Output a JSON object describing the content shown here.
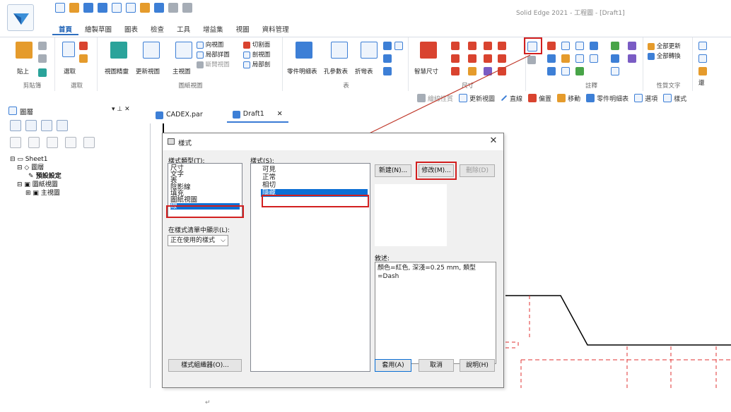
{
  "window": {
    "title": "Solid Edge 2021 - 工程圖 - [Draft1]"
  },
  "ribbon": {
    "tabs": [
      "首頁",
      "繪製草圖",
      "圖表",
      "檢查",
      "工具",
      "增益集",
      "視圖",
      "資料管理"
    ],
    "active_tab": "首頁",
    "clipboard": {
      "paste": "貼上",
      "group": "剪貼簿"
    },
    "select": {
      "select": "選取",
      "group": "選取"
    },
    "views": {
      "wizard": "視圖精靈",
      "update": "更新視圖",
      "main": "主視圖",
      "aux": "向視圖",
      "detail": "局部詳圖",
      "broken": "斷開視圖",
      "section": "切割面",
      "cutaway": "剖視圖",
      "partial": "局部剖",
      "group": "圖紙視圖"
    },
    "table": {
      "parts_list": "零件明細表",
      "hole_table": "孔參數表",
      "bend_table": "折彎表",
      "group": "表"
    },
    "dimension": {
      "smart": "智慧尺寸",
      "group": "尺寸"
    },
    "annotation": {
      "group": "註釋"
    },
    "property_text": {
      "update_all": "全部更新",
      "convert_all": "全部轉換",
      "group": "性質文字"
    },
    "extra": {
      "back": "還"
    }
  },
  "toolbar2": {
    "items": [
      "繪線性質",
      "更新視圖",
      "直線",
      "偏置",
      "移動",
      "零件明細表",
      "選項",
      "樣式"
    ]
  },
  "left_panel": {
    "title": "圖層",
    "tree": [
      "Sheet1",
      "圖層",
      "預設設定",
      "圖紙視圖",
      "主視圖"
    ]
  },
  "doc_tabs": [
    {
      "label": "CADEX.par",
      "active": false
    },
    {
      "label": "Draft1",
      "active": true
    }
  ],
  "dialog": {
    "title": "樣式",
    "style_type_label": "樣式類型(T):",
    "style_types": [
      "尺寸",
      "文字",
      "表",
      "陰影線",
      "填充",
      "圖紙視圖",
      "線"
    ],
    "selected_style_type": "線",
    "styles_label": "樣式(S):",
    "styles": [
      "可見",
      "正常",
      "相切",
      "隱藏"
    ],
    "selected_style": "隱藏",
    "show_in_list_label": "在樣式清單中顯示(L):",
    "show_in_list_value": "正在使用的樣式",
    "new_button": "新建(N)...",
    "modify_button": "修改(M)...",
    "delete_button": "刪除(D)",
    "description_label": "敘述:",
    "description": "顏色=紅色, 深淺=0.25 mm, 類型=Dash",
    "organizer_button": "樣式組織器(O)...",
    "apply_button": "套用(A)",
    "cancel_button": "取消",
    "help_button": "說明(H)"
  },
  "colors": {
    "highlight": "#d21f1f",
    "selection": "#0b6fd4",
    "hidden_line": "#e03030"
  }
}
